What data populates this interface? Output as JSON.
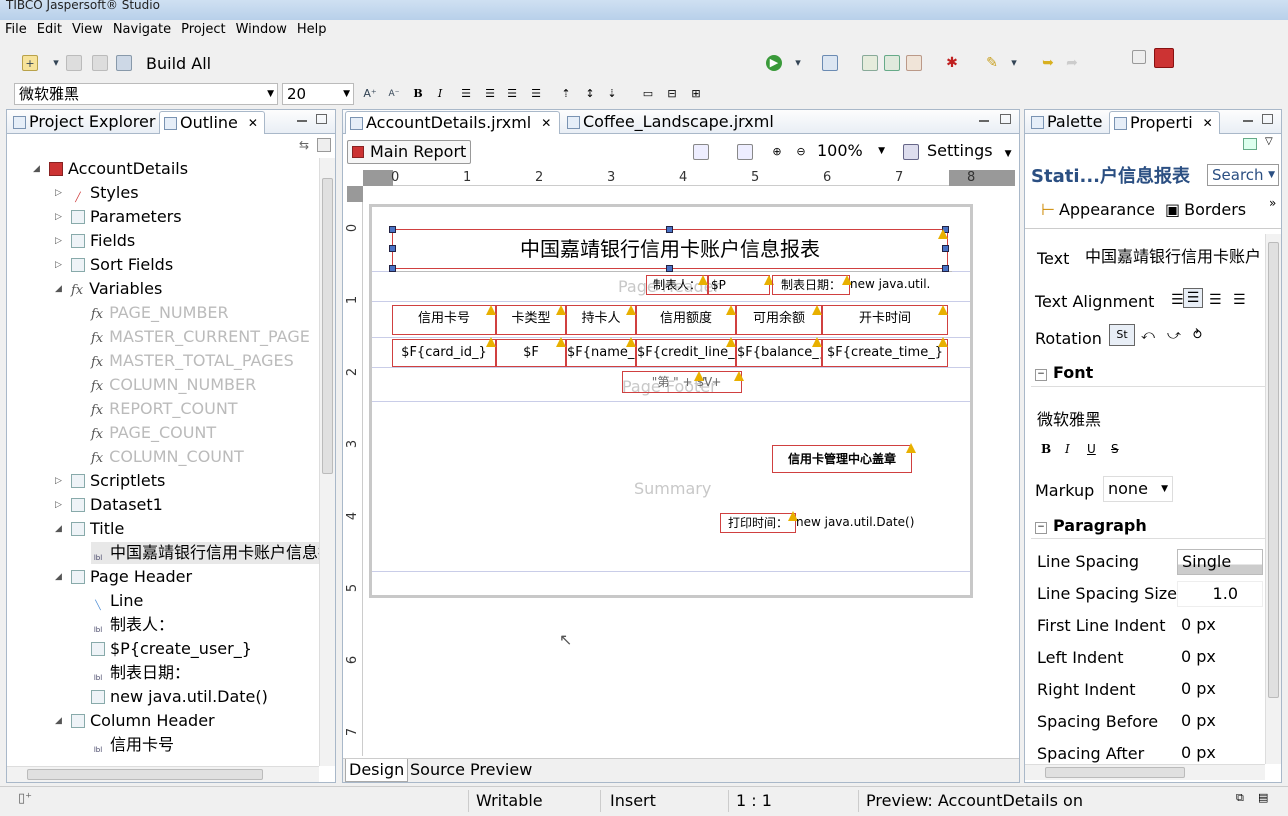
{
  "window": {
    "title": "TIBCO Jaspersoft® Studio"
  },
  "menu": [
    "File",
    "Edit",
    "View",
    "Navigate",
    "Project",
    "Window",
    "Help"
  ],
  "toolbar": {
    "build_all": "Build All",
    "font_name": "微软雅黑",
    "font_size": "20"
  },
  "left_panel": {
    "tabs": [
      "Project Explorer",
      "Outline"
    ],
    "tree": [
      {
        "label": "AccountDetails",
        "level": 0,
        "expanded": true,
        "icon": "report-icon"
      },
      {
        "label": "Styles",
        "level": 1,
        "icon": "styles-icon"
      },
      {
        "label": "Parameters",
        "level": 1,
        "icon": "parameters-icon"
      },
      {
        "label": "Fields",
        "level": 1,
        "icon": "fields-icon"
      },
      {
        "label": "Sort Fields",
        "level": 1,
        "icon": "sort-fields-icon"
      },
      {
        "label": "Variables",
        "level": 1,
        "expanded": true,
        "icon": "fx-icon"
      },
      {
        "label": "PAGE_NUMBER",
        "level": 2,
        "disabled": true,
        "icon": "fx-icon"
      },
      {
        "label": "MASTER_CURRENT_PAGE",
        "level": 2,
        "disabled": true,
        "icon": "fx-icon"
      },
      {
        "label": "MASTER_TOTAL_PAGES",
        "level": 2,
        "disabled": true,
        "icon": "fx-icon"
      },
      {
        "label": "COLUMN_NUMBER",
        "level": 2,
        "disabled": true,
        "icon": "fx-icon"
      },
      {
        "label": "REPORT_COUNT",
        "level": 2,
        "disabled": true,
        "icon": "fx-icon"
      },
      {
        "label": "PAGE_COUNT",
        "level": 2,
        "disabled": true,
        "icon": "fx-icon"
      },
      {
        "label": "COLUMN_COUNT",
        "level": 2,
        "disabled": true,
        "icon": "fx-icon"
      },
      {
        "label": "Scriptlets",
        "level": 1,
        "icon": "scriptlets-icon"
      },
      {
        "label": "Dataset1",
        "level": 1,
        "icon": "dataset-icon"
      },
      {
        "label": "Title",
        "level": 1,
        "expanded": true,
        "icon": "band-icon"
      },
      {
        "label": "中国嘉靖银行信用卡账户信息报表",
        "level": 2,
        "selected": true,
        "icon": "label-icon"
      },
      {
        "label": "Page Header",
        "level": 1,
        "expanded": true,
        "icon": "band-icon"
      },
      {
        "label": "Line",
        "level": 2,
        "icon": "line-icon"
      },
      {
        "label": "制表人：",
        "level": 2,
        "icon": "label-icon"
      },
      {
        "label": "$P{create_user_}",
        "level": 2,
        "icon": "textfield-icon"
      },
      {
        "label": "制表日期：",
        "level": 2,
        "icon": "label-icon"
      },
      {
        "label": "new java.util.Date()",
        "level": 2,
        "icon": "textfield-icon"
      },
      {
        "label": "Column Header",
        "level": 1,
        "expanded": true,
        "icon": "band-icon"
      },
      {
        "label": "信用卡号",
        "level": 2,
        "icon": "label-icon"
      }
    ]
  },
  "editor": {
    "tabs": [
      "AccountDetails.jrxml",
      "Coffee_Landscape.jrxml"
    ],
    "main_report": "Main Report",
    "zoom": "100%",
    "settings": "Settings",
    "ruler_ticks": [
      "0",
      "1",
      "2",
      "3",
      "4",
      "5",
      "6",
      "7",
      "8"
    ],
    "vruler_ticks": [
      "0",
      "1",
      "2",
      "3",
      "4",
      "5",
      "6",
      "7"
    ],
    "report_title": "中国嘉靖银行信用卡账户信息报表",
    "page_header": {
      "maker": "制表人：",
      "maker_param": "$P",
      "date_label": "制表日期：",
      "date_expr": "new java.util."
    },
    "band_labels": {
      "page_header": "Page Header",
      "page_footer": "Page Footer",
      "summary": "Summary"
    },
    "column_headers": [
      "信用卡号",
      "卡类型",
      "持卡人",
      "信用额度",
      "可用余额",
      "开卡时间"
    ],
    "detail_fields": [
      "$F{card_id_}",
      "$F",
      "$F{name_}",
      "$F{credit_line_}",
      "$F{balance_}",
      "$F{create_time_}"
    ],
    "footer_expr": "\"第 \" + $V",
    "footer_expr2": "\" + ",
    "stamp": "信用卡管理中心盖章",
    "print_time_label": "打印时间：",
    "print_time_expr": "new java.util.Date()",
    "bottom_tabs": [
      "Design",
      "Source",
      "Preview"
    ]
  },
  "right_panel": {
    "tabs": [
      "Palette",
      "Properti"
    ],
    "header": "Stati...户信息报表",
    "search": "Search",
    "subtabs": [
      "Appearance",
      "Borders"
    ],
    "text_label": "Text",
    "text_value": "中国嘉靖银行信用卡账户信息报表",
    "text_alignment": "Text Alignment",
    "rotation": "Rotation",
    "font_section": "Font",
    "font_name": "微软雅黑",
    "font_styles": [
      "B",
      "I",
      "U",
      "S"
    ],
    "markup_label": "Markup",
    "markup_value": "none",
    "paragraph_section": "Paragraph",
    "paragraph": [
      {
        "label": "Line Spacing",
        "value": "Single"
      },
      {
        "label": "Line Spacing Size",
        "value": "1.0"
      },
      {
        "label": "First Line Indent",
        "value": "0 px"
      },
      {
        "label": "Left Indent",
        "value": "0 px"
      },
      {
        "label": "Right Indent",
        "value": "0 px"
      },
      {
        "label": "Spacing Before",
        "value": "0 px"
      },
      {
        "label": "Spacing After",
        "value": "0 px"
      }
    ]
  },
  "status": {
    "writable": "Writable",
    "insert": "Insert",
    "position": "1 : 1",
    "preview": "Preview: AccountDetails on"
  },
  "colors": {
    "accent": "#4a72c4",
    "warning": "#e8b000",
    "element_border": "#d04040"
  }
}
